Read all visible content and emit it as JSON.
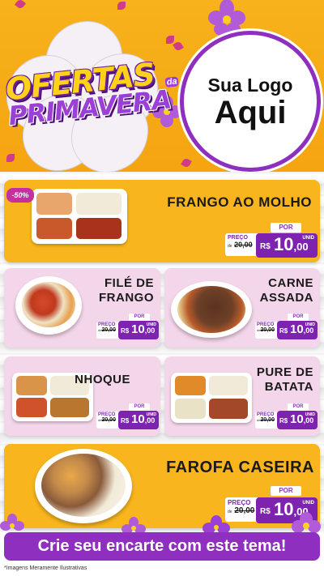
{
  "header": {
    "title_line1": "OFERTAS",
    "title_small": "da",
    "title_line2": "PRIMAVERA",
    "logo_line1": "Sua Logo",
    "logo_line2": "Aqui"
  },
  "colors": {
    "brand_purple": "#8e2fbf",
    "header_orange": "#f7b21c",
    "card_yellow": "#f8b51d",
    "card_pink": "#f4d6ea"
  },
  "products": [
    {
      "name": "FRANGO AO MOLHO",
      "discount": "-50%",
      "por": "POR",
      "preco_label": "PREÇO",
      "de": "de",
      "old_price": "20,00",
      "currency": "R$",
      "price_int": "10",
      "price_dec": ",00",
      "unit": "UNID"
    },
    {
      "name_line1": "FILÉ DE",
      "name_line2": "FRANGO",
      "por": "POR",
      "preco_label": "PREÇO",
      "de": "de",
      "old_price": "20,00",
      "currency": "R$",
      "price_int": "10",
      "price_dec": ",00",
      "unit": "UNID"
    },
    {
      "name_line1": "CARNE",
      "name_line2": "ASSADA",
      "por": "POR",
      "preco_label": "PREÇO",
      "de": "de",
      "old_price": "20,00",
      "currency": "R$",
      "price_int": "10",
      "price_dec": ",00",
      "unit": "UNID"
    },
    {
      "name": "NHOQUE",
      "por": "POR",
      "preco_label": "PREÇO",
      "de": "de",
      "old_price": "20,00",
      "currency": "R$",
      "price_int": "10",
      "price_dec": ",00",
      "unit": "UNID"
    },
    {
      "name_line1": "PURE DE",
      "name_line2": "BATATA",
      "por": "POR",
      "preco_label": "PREÇO",
      "de": "de",
      "old_price": "20,00",
      "currency": "R$",
      "price_int": "10",
      "price_dec": ",00",
      "unit": "UNID"
    },
    {
      "name": "FAROFA CASEIRA",
      "por": "POR",
      "preco_label": "PREÇO",
      "de": "de",
      "old_price": "20,00",
      "currency": "R$",
      "price_int": "10",
      "price_dec": ",00",
      "unit": "UNID"
    }
  ],
  "cta_label": "Crie seu encarte com este tema!",
  "disclaimer": "*Imagens Meramente Ilustrativas"
}
